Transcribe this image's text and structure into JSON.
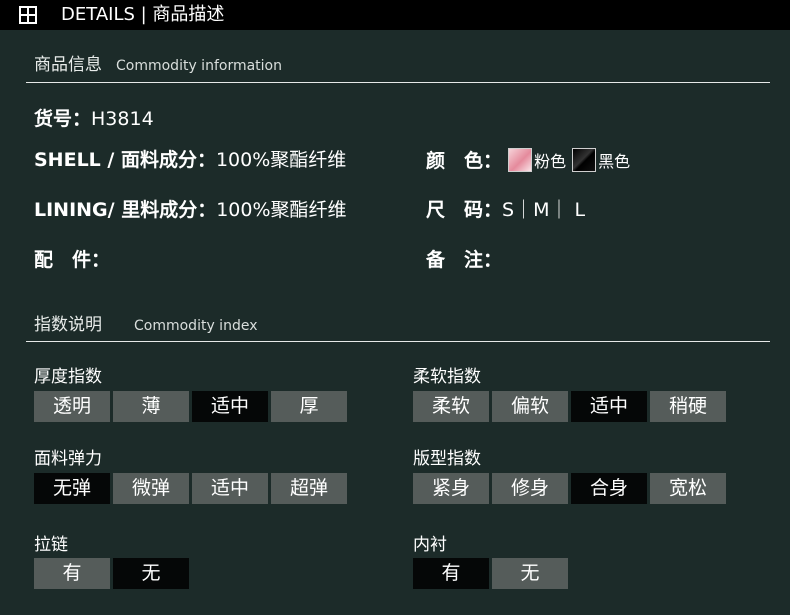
{
  "header": {
    "title": "DETAILS | 商品描述",
    "icon": "grid-icon"
  },
  "commodity_info": {
    "title_zh": "商品信息",
    "title_en": "Commodity information",
    "item_no": {
      "label": "货号：",
      "value": "H3814"
    },
    "shell": {
      "label": "SHELL / 面料成分：",
      "value": "100%聚酯纤维"
    },
    "lining": {
      "label": "LINING/ 里料成分：",
      "value": "100%聚酯纤维"
    },
    "accessories": {
      "label": "配　件：",
      "value": ""
    },
    "color": {
      "label": "颜　色：",
      "options": [
        {
          "name": "粉色",
          "swatch": "#e8a0ae"
        },
        {
          "name": "黑色",
          "swatch": "#000000"
        }
      ]
    },
    "size": {
      "label": "尺　码：",
      "value": "S｜M｜ L"
    },
    "remark": {
      "label": "备　注：",
      "value": ""
    }
  },
  "commodity_index": {
    "title_zh": "指数说明",
    "title_en": "Commodity index",
    "thickness": {
      "label": "厚度指数",
      "options": [
        "透明",
        "薄",
        "适中",
        "厚"
      ],
      "selected": 2
    },
    "softness": {
      "label": "柔软指数",
      "options": [
        "柔软",
        "偏软",
        "适中",
        "稍硬"
      ],
      "selected": 2
    },
    "elasticity": {
      "label": "面料弹力",
      "options": [
        "无弹",
        "微弹",
        "适中",
        "超弹"
      ],
      "selected": 0
    },
    "fit": {
      "label": "版型指数",
      "options": [
        "紧身",
        "修身",
        "合身",
        "宽松"
      ],
      "selected": 2
    },
    "zipper": {
      "label": "拉链",
      "options": [
        "有",
        "无"
      ],
      "selected": 1
    },
    "lining": {
      "label": "内衬",
      "options": [
        "有",
        "无"
      ],
      "selected": 0
    }
  },
  "colors": {
    "background": "#1c2b29",
    "option_bg": "#555c5a",
    "option_active_bg": "#050707",
    "topbar_bg": "#000000"
  }
}
